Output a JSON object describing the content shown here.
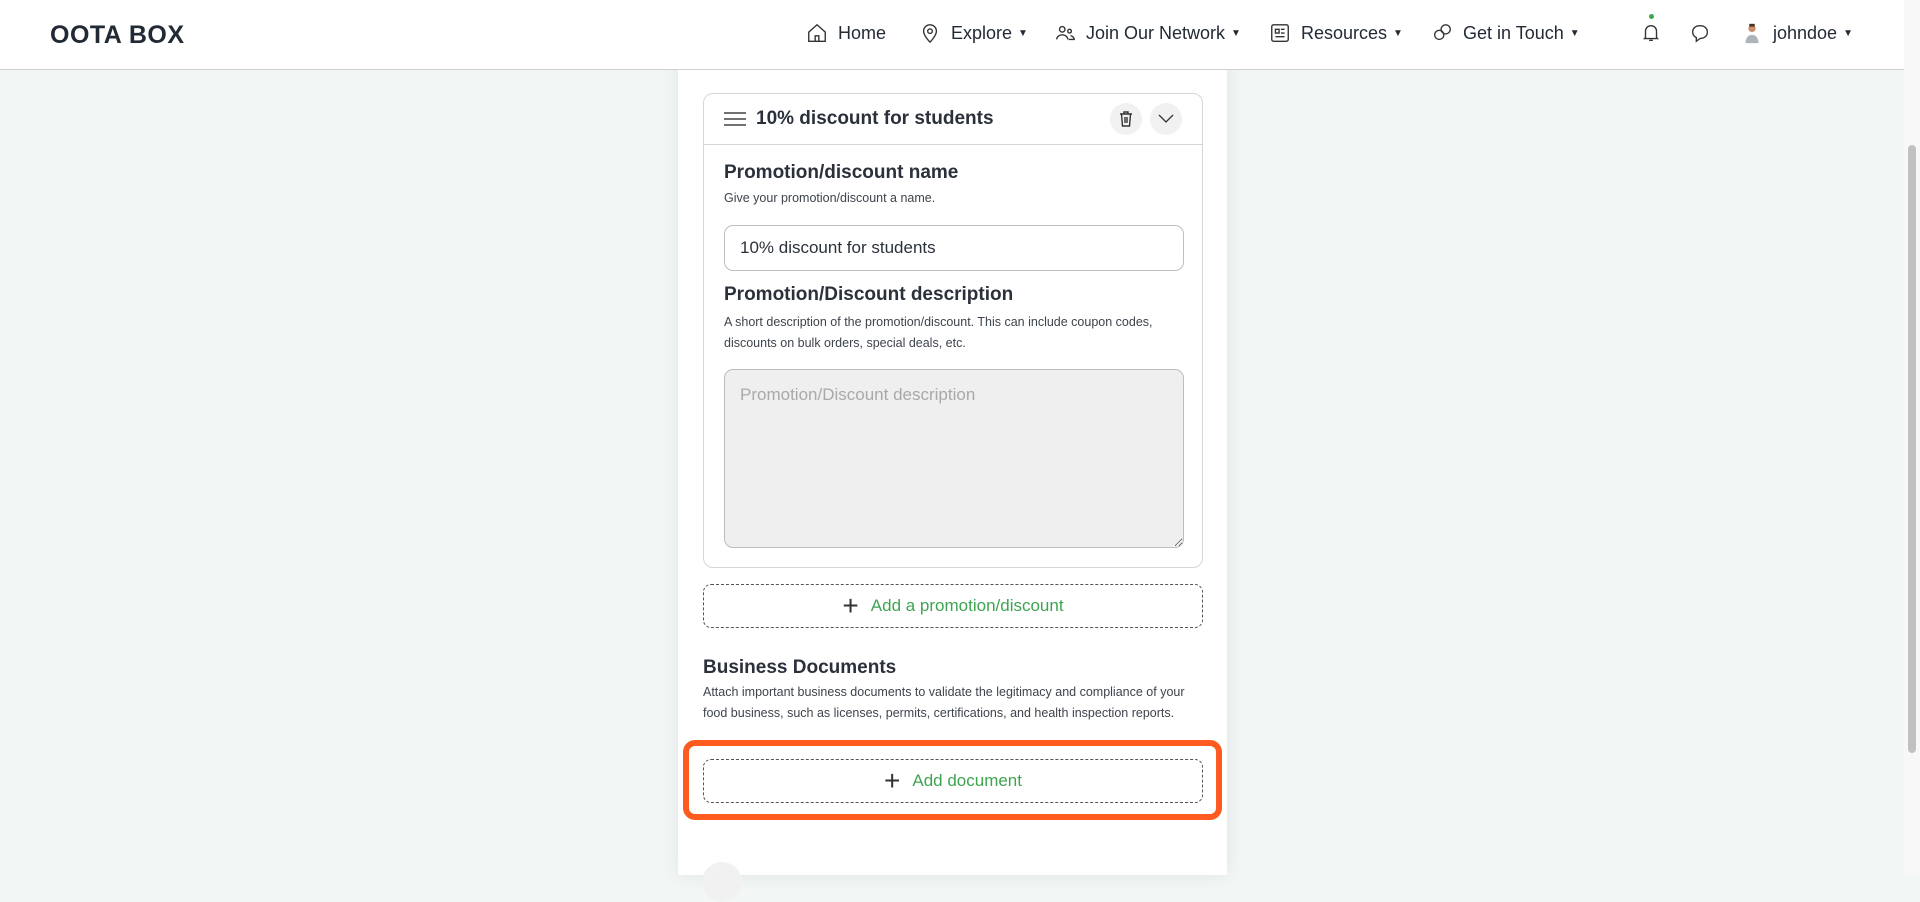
{
  "nav": {
    "logo": "OOTA BOX",
    "items": [
      {
        "label": "Home",
        "icon": "home-icon",
        "caret": false
      },
      {
        "label": "Explore",
        "icon": "map-pin-icon",
        "caret": true
      },
      {
        "label": "Join Our Network",
        "icon": "users-icon",
        "caret": true
      },
      {
        "label": "Resources",
        "icon": "newspaper-icon",
        "caret": true
      },
      {
        "label": "Get in Touch",
        "icon": "chat-bubbles-icon",
        "caret": true
      }
    ],
    "user": "johndoe",
    "notification_dot_color": "#3fa452"
  },
  "promotion": {
    "title": "10% discount for students",
    "name_label": "Promotion/discount name",
    "name_help": "Give your promotion/discount a name.",
    "name_value": "10% discount for students",
    "desc_label": "Promotion/Discount description",
    "desc_help": "A short description of the promotion/discount. This can include coupon codes, discounts on bulk orders, special deals, etc.",
    "desc_placeholder": "Promotion/Discount description",
    "add_label": "Add a promotion/discount"
  },
  "documents": {
    "heading": "Business Documents",
    "help": "Attach important business documents to validate the legitimacy and compliance of your food business, such as licenses, permits, certifications, and health inspection reports.",
    "add_label": "Add document"
  },
  "colors": {
    "accent": "#3fa452",
    "highlight": "#ff5a1f"
  }
}
